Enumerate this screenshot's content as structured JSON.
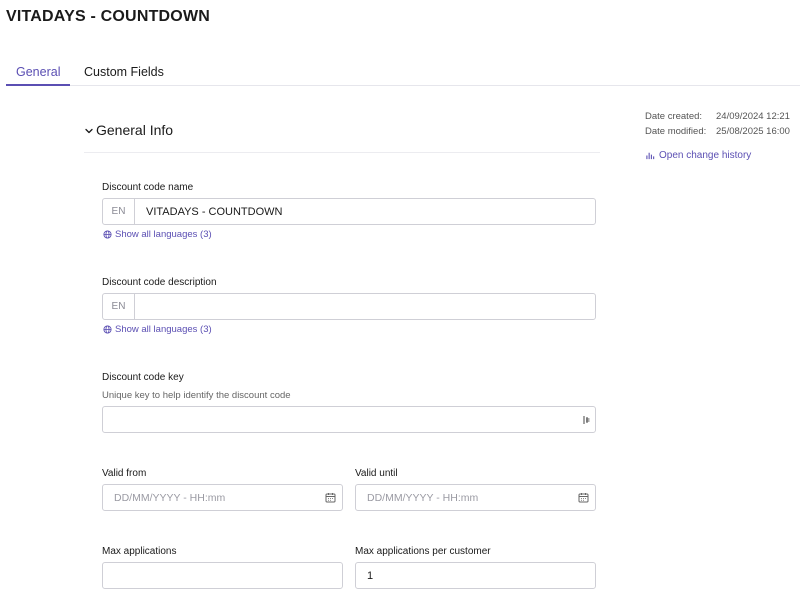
{
  "page": {
    "title": "VITADAYS - COUNTDOWN"
  },
  "tabs": [
    {
      "label": "General"
    },
    {
      "label": "Custom Fields"
    }
  ],
  "section": {
    "title": "General Info"
  },
  "meta": {
    "created_label": "Date created:",
    "created_value": "24/09/2024 12:21",
    "modified_label": "Date modified:",
    "modified_value": "25/08/2025 16:00",
    "history_link": "Open change history"
  },
  "fields": {
    "name": {
      "label": "Discount code name",
      "lang": "EN",
      "value": "VITADAYS - COUNTDOWN",
      "languages_link": "Show all languages (3)"
    },
    "description": {
      "label": "Discount code description",
      "lang": "EN",
      "value": "",
      "languages_link": "Show all languages (3)"
    },
    "key": {
      "label": "Discount code key",
      "hint": "Unique key to help identify the discount code",
      "value": ""
    },
    "valid_from": {
      "label": "Valid from",
      "placeholder": "DD/MM/YYYY - HH:mm"
    },
    "valid_until": {
      "label": "Valid until",
      "placeholder": "DD/MM/YYYY - HH:mm"
    },
    "max_applications": {
      "label": "Max applications",
      "value": ""
    },
    "max_applications_per_customer": {
      "label": "Max applications per customer",
      "value": "1"
    }
  },
  "colors": {
    "accent": "#5b4fb3",
    "border": "#cfcfd6"
  }
}
